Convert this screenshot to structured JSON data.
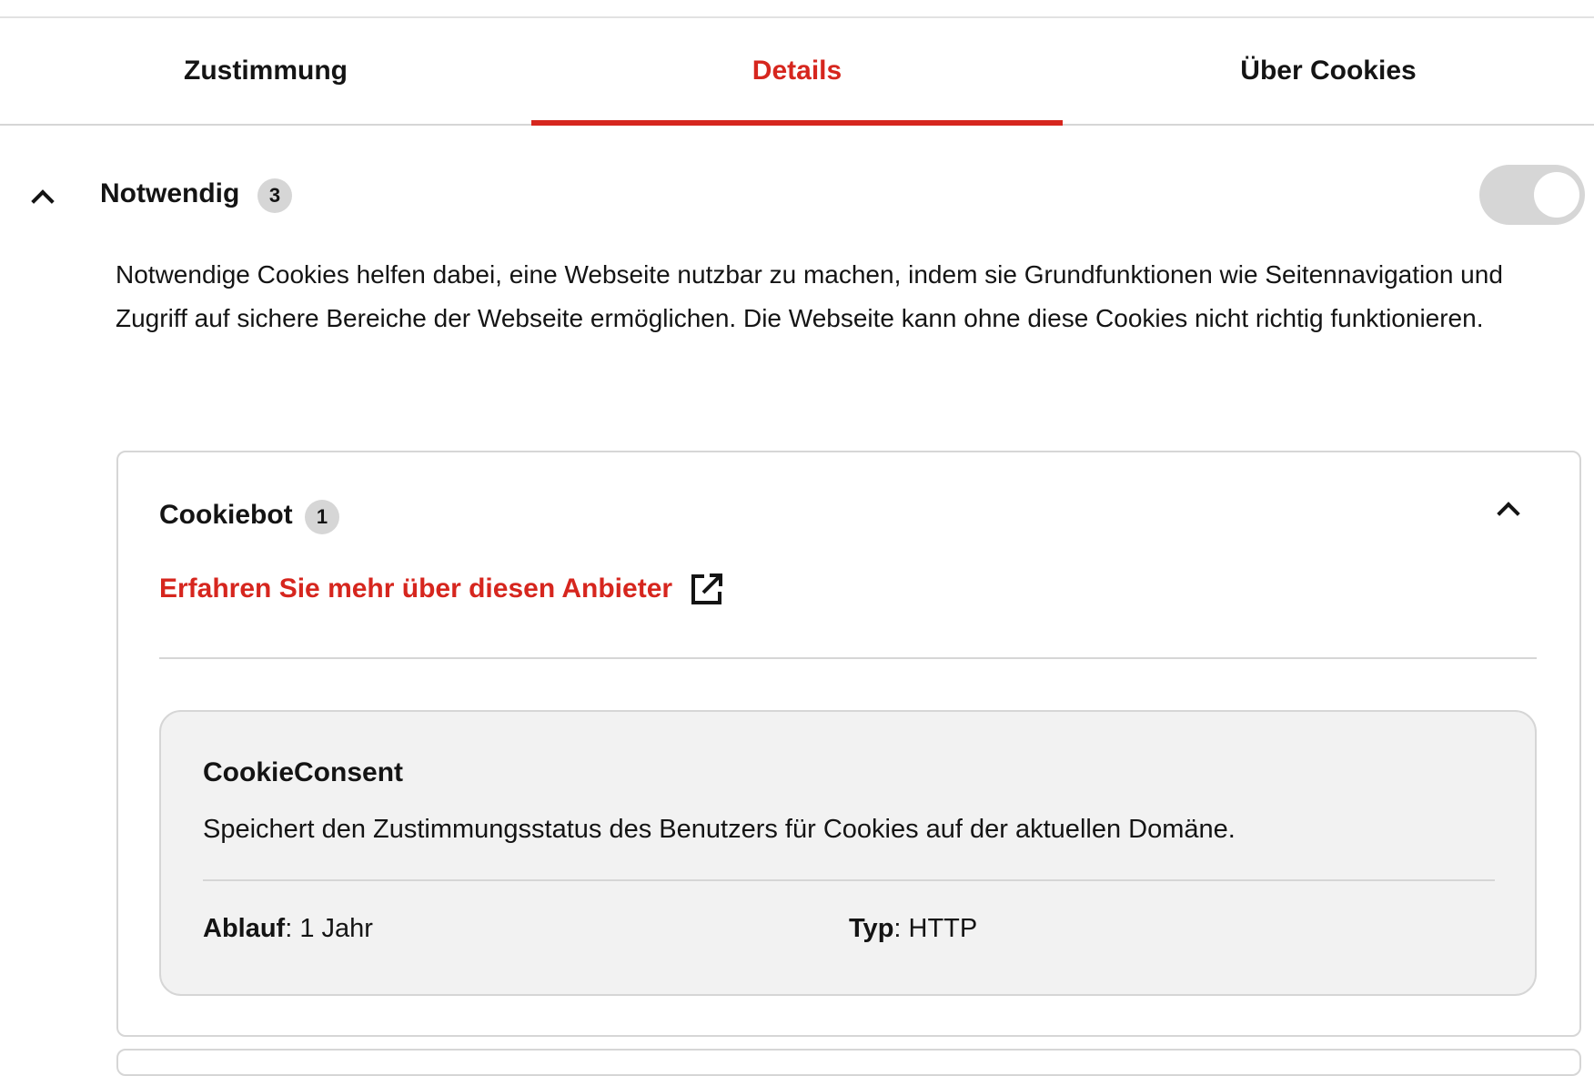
{
  "tabs": [
    {
      "label": "Zustimmung",
      "active": false
    },
    {
      "label": "Details",
      "active": true
    },
    {
      "label": "Über Cookies",
      "active": false
    }
  ],
  "category": {
    "title": "Notwendig",
    "count": "3",
    "expanded": true,
    "toggle_enabled": true,
    "description": "Notwendige Cookies helfen dabei, eine Webseite nutzbar zu machen, indem sie Grundfunktionen wie Seitennavigation und Zugriff auf sichere Bereiche der Webseite ermöglichen. Die Webseite kann ohne diese Cookies nicht richtig funktionieren."
  },
  "vendor": {
    "name": "Cookiebot",
    "count": "1",
    "link_label": "Erfahren Sie mehr über diesen Anbieter",
    "link_icon": "external-link-icon"
  },
  "cookie": {
    "name": "CookieConsent",
    "description": "Speichert den Zustimmungsstatus des Benutzers für Cookies auf der aktuellen Domäne.",
    "expiry_label": "Ablauf",
    "expiry_value": ": 1 Jahr",
    "type_label": "Typ",
    "type_value": ": HTTP"
  },
  "colors": {
    "accent": "#d6261e",
    "text": "#141414",
    "border": "#d6d6d6",
    "card_bg": "#f2f2f2"
  }
}
